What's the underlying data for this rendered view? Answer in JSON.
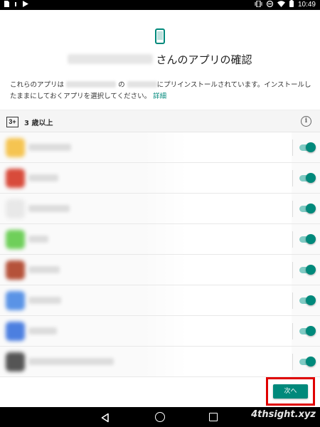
{
  "status_bar": {
    "left_icons": [
      "sim-card-icon",
      "small-indicator-icon",
      "play-store-icon"
    ],
    "right_icons": [
      "vibrate-icon",
      "do-not-disturb-icon",
      "wifi-icon",
      "battery-icon"
    ],
    "time": "10:49"
  },
  "header": {
    "icon": "phone-icon",
    "title_suffix": "さんのアプリの確認",
    "desc_part1": "これらのアプリは",
    "desc_part2": "の",
    "desc_part3": "にプリインストールされています。インストールしたままにしておくアプリを選択してください。",
    "details_link": "詳細"
  },
  "section": {
    "rating_badge": "3+",
    "label": "3 歳以上",
    "info_icon": "info-icon"
  },
  "apps": [
    {
      "icon_color": "#f5c451",
      "enabled": true
    },
    {
      "icon_color": "#d84b3b",
      "enabled": true
    },
    {
      "icon_color": "#e8e8e8",
      "enabled": true
    },
    {
      "icon_color": "#6fcf5a",
      "enabled": true
    },
    {
      "icon_color": "#b5523a",
      "enabled": true
    },
    {
      "icon_color": "#5a93e6",
      "enabled": true
    },
    {
      "icon_color": "#4c7fe0",
      "enabled": true
    },
    {
      "icon_color": "#555555",
      "enabled": true
    }
  ],
  "footer": {
    "next_label": "次へ"
  },
  "nav_bar": {
    "icons": [
      "back-icon",
      "home-icon",
      "recents-icon"
    ],
    "watermark": "4thsight.xyz"
  },
  "colors": {
    "accent": "#00897b",
    "toggle_track": "#80cbc4",
    "highlight": "#e00000"
  }
}
